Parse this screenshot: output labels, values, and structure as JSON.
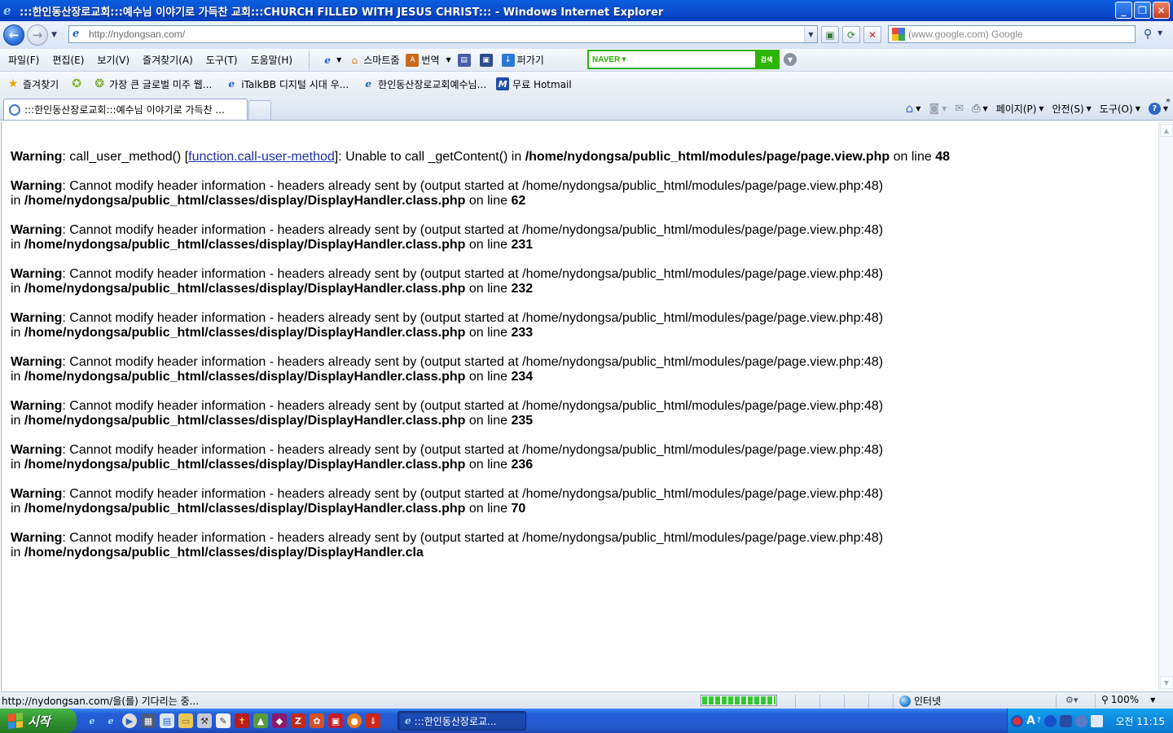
{
  "window": {
    "title": ":::한인동산장로교회:::예수님 이야기로 가득찬 교회:::CHURCH FILLED WITH JESUS CHRIST::: - Windows Internet Explorer",
    "minimize": "_",
    "maximize": "❐",
    "close": "✕"
  },
  "address": {
    "url": "http://nydongsan.com/",
    "search_placeholder": "(www.google.com) Google"
  },
  "menu": [
    "파일(F)",
    "편집(E)",
    "보기(V)",
    "즐겨찾기(A)",
    "도구(T)",
    "도움말(H)"
  ],
  "toolbar": {
    "smartzoom": "스마트줌",
    "translate": "번역",
    "pagesave": "퍼가기",
    "naver_logo": "NAVER",
    "naver_search": "검색"
  },
  "favorites": {
    "label": "즐겨찾기",
    "items": [
      "가장 큰 글로벌 미주 웹...",
      "iTalkBB 디지털 시대 우...",
      "한인동산장로교회예수님...",
      "무료 Hotmail"
    ]
  },
  "tab": {
    "label": ":::한인동산장로교회:::예수님 이야기로 가득찬 ..."
  },
  "commands": [
    "페이지(P)",
    "안전(S)",
    "도구(O)"
  ],
  "content": {
    "first": {
      "label": "Warning",
      "pre": ": call_user_method() [",
      "link": "function.call-user-method",
      "mid": "]: Unable to call _getContent() in ",
      "path": "/home/nydongsa/public_html/modules/page/page.view.php",
      "online": " on line ",
      "line": "48"
    },
    "warnings": [
      {
        "label": "Warning",
        "text": ": Cannot modify header information - headers already sent by (output started at /home/nydongsa/public_html/modules/page/page.view.php:48)",
        "in": "in ",
        "path": "/home/nydongsa/public_html/classes/display/DisplayHandler.class.php",
        "online": " on line ",
        "line": "62"
      },
      {
        "label": "Warning",
        "text": ": Cannot modify header information - headers already sent by (output started at /home/nydongsa/public_html/modules/page/page.view.php:48)",
        "in": "in ",
        "path": "/home/nydongsa/public_html/classes/display/DisplayHandler.class.php",
        "online": " on line ",
        "line": "231"
      },
      {
        "label": "Warning",
        "text": ": Cannot modify header information - headers already sent by (output started at /home/nydongsa/public_html/modules/page/page.view.php:48)",
        "in": "in ",
        "path": "/home/nydongsa/public_html/classes/display/DisplayHandler.class.php",
        "online": " on line ",
        "line": "232"
      },
      {
        "label": "Warning",
        "text": ": Cannot modify header information - headers already sent by (output started at /home/nydongsa/public_html/modules/page/page.view.php:48)",
        "in": "in ",
        "path": "/home/nydongsa/public_html/classes/display/DisplayHandler.class.php",
        "online": " on line ",
        "line": "233"
      },
      {
        "label": "Warning",
        "text": ": Cannot modify header information - headers already sent by (output started at /home/nydongsa/public_html/modules/page/page.view.php:48)",
        "in": "in ",
        "path": "/home/nydongsa/public_html/classes/display/DisplayHandler.class.php",
        "online": " on line ",
        "line": "234"
      },
      {
        "label": "Warning",
        "text": ": Cannot modify header information - headers already sent by (output started at /home/nydongsa/public_html/modules/page/page.view.php:48)",
        "in": "in ",
        "path": "/home/nydongsa/public_html/classes/display/DisplayHandler.class.php",
        "online": " on line ",
        "line": "235"
      },
      {
        "label": "Warning",
        "text": ": Cannot modify header information - headers already sent by (output started at /home/nydongsa/public_html/modules/page/page.view.php:48)",
        "in": "in ",
        "path": "/home/nydongsa/public_html/classes/display/DisplayHandler.class.php",
        "online": " on line ",
        "line": "236"
      },
      {
        "label": "Warning",
        "text": ": Cannot modify header information - headers already sent by (output started at /home/nydongsa/public_html/modules/page/page.view.php:48)",
        "in": "in ",
        "path": "/home/nydongsa/public_html/classes/display/DisplayHandler.class.php",
        "online": " on line ",
        "line": "70"
      },
      {
        "label": "Warning",
        "text": ": Cannot modify header information - headers already sent by (output started at /home/nydongsa/public_html/modules/page/page.view.php:48)",
        "in": "in ",
        "path": "/home/nydongsa/public_html/classes/display/DisplayHandler.cla",
        "online": "",
        "line": ""
      }
    ]
  },
  "status": {
    "text": "http://nydongsan.com/을(를) 기다리는 중...",
    "zone": "인터넷",
    "zoom": "100%",
    "progress_percent": 100
  },
  "taskbar": {
    "start": "시작",
    "task": ":::한인동산장로교...",
    "clock": "오전 11:15"
  },
  "colors": {
    "titlebar": "#0a4fd0",
    "link": "#1f2fa8",
    "naver": "#2db400",
    "taskbar": "#245edb"
  }
}
